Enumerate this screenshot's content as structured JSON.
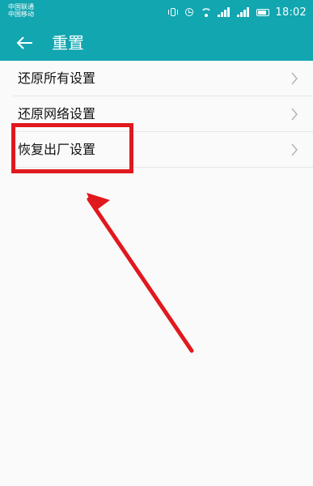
{
  "status_bar": {
    "carrier_1": "中国联通",
    "carrier_2": "中国移动",
    "time": "18:02",
    "icons": [
      "vibrate-icon",
      "alarm-icon",
      "wifi-icon",
      "signal-icon",
      "signal-icon",
      "battery-icon"
    ]
  },
  "header": {
    "title": "重置",
    "back_icon": "back-arrow-icon"
  },
  "menu": {
    "items": [
      {
        "label": "还原所有设置"
      },
      {
        "label": "还原网络设置"
      },
      {
        "label": "恢复出厂设置"
      }
    ]
  },
  "colors": {
    "accent": "#11a6b0",
    "annotation": "#e0191e",
    "background": "#fafafa",
    "divider": "#e7e7e7",
    "text": "#111111",
    "chevron": "#b7b7b7"
  }
}
